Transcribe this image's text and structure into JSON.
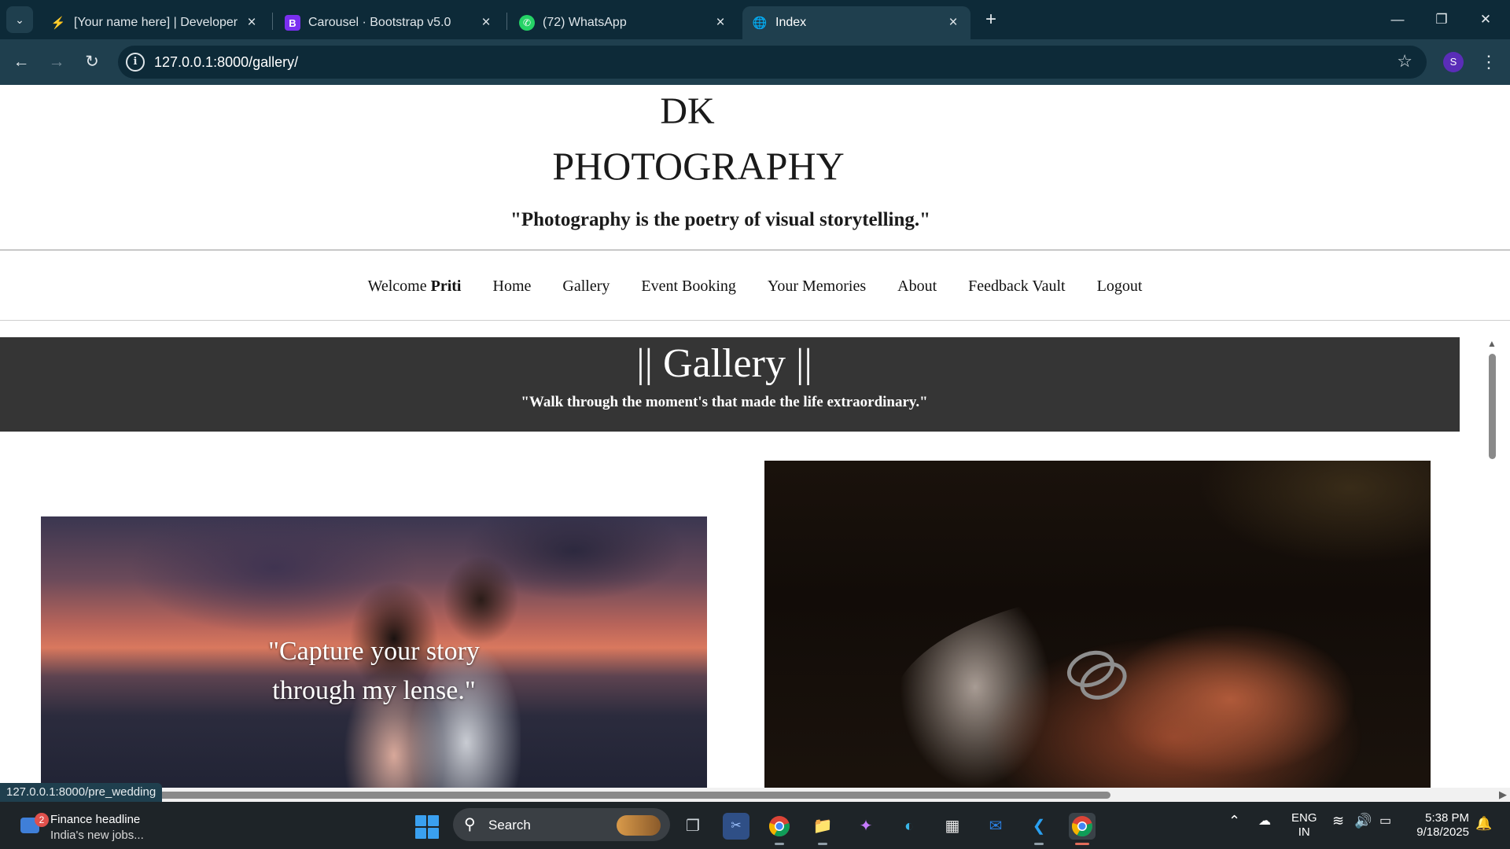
{
  "browser": {
    "tabs": [
      {
        "title": "[Your name here] | Developer",
        "icon": "lightning-icon",
        "active": false
      },
      {
        "title": "Carousel · Bootstrap v5.0",
        "icon": "bootstrap-icon",
        "active": false
      },
      {
        "title": "(72) WhatsApp",
        "icon": "whatsapp-icon",
        "active": false
      },
      {
        "title": "Index",
        "icon": "globe-icon",
        "active": true
      }
    ],
    "url": "127.0.0.1:8000/gallery/",
    "profile_initial": "S",
    "status_url": "127.0.0.1:8000/pre_wedding"
  },
  "site": {
    "brand_line1": "DK",
    "brand_line2": "PHOTOGRAPHY",
    "tagline": "\"Photography is the poetry of visual storytelling.\"",
    "nav": {
      "welcome_prefix": "Welcome",
      "welcome_user": "Priti",
      "items": [
        "Home",
        "Gallery",
        "Event Booking",
        "Your Memories",
        "About",
        "Feedback Vault",
        "Logout"
      ]
    },
    "gallery": {
      "title": "|| Gallery ||",
      "subtitle": "\"Walk through the moment's that made the life extraordinary.\""
    },
    "photo_quote_line1": "\"Capture your story",
    "photo_quote_line2": "through my lense.\""
  },
  "taskbar": {
    "news_badge": "2",
    "news_title": "Finance headline",
    "news_sub": "India's new jobs...",
    "search_label": "Search",
    "lang_line1": "ENG",
    "lang_line2": "IN",
    "time": "5:38 PM",
    "date": "9/18/2025"
  },
  "colors": {
    "chrome_dark": "#0d2a38",
    "chrome_toolbar": "#1f3f4e",
    "banner": "#353535",
    "taskbar": "#1e2428"
  }
}
